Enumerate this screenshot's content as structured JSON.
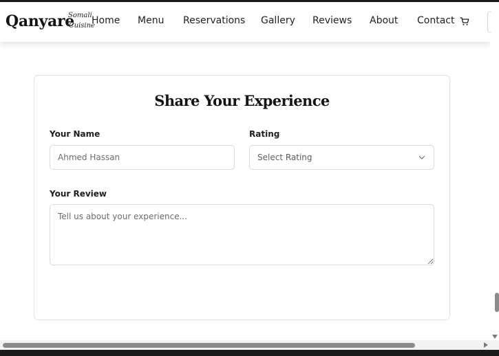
{
  "brand": {
    "name": "Qanyare",
    "tagline_line1": "Somali",
    "tagline_line2": "Cuisine"
  },
  "nav": {
    "items": [
      "Home",
      "Menu",
      "Reservations",
      "Gallery",
      "Reviews",
      "About",
      "Contact"
    ]
  },
  "form": {
    "title": "Share Your Experience",
    "name_label": "Your Name",
    "name_placeholder": "Ahmed Hassan",
    "rating_label": "Rating",
    "rating_selected": "Select Rating",
    "review_label": "Your Review",
    "review_placeholder": "Tell us about your experience..."
  },
  "icons": {
    "cart": "cart-icon",
    "select": "chevron-down-icon",
    "resize": "resize-grip-icon"
  }
}
